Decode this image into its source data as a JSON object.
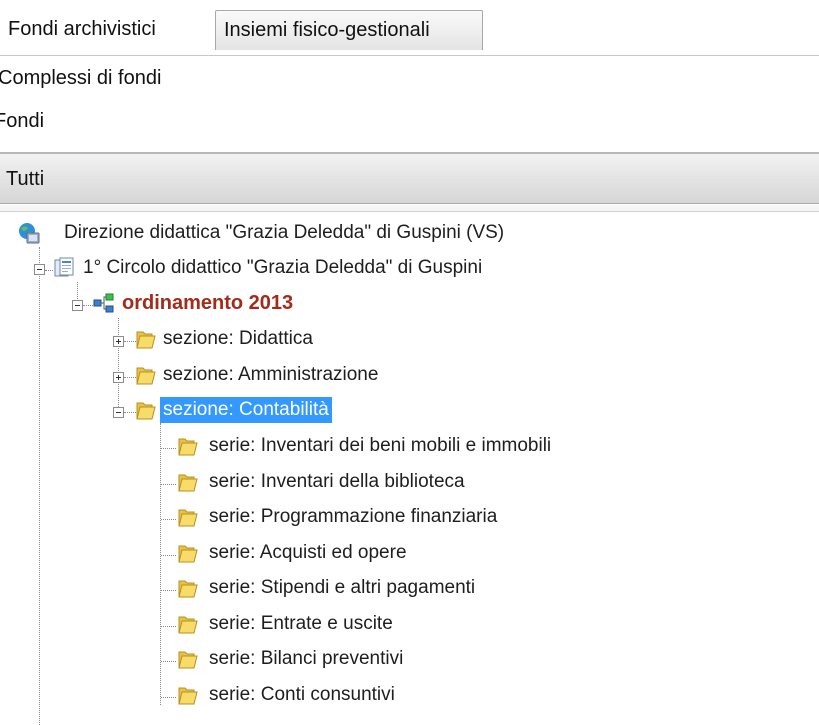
{
  "tabs": {
    "fondi_archivistici": "Fondi archivistici",
    "insiemi_fisico_gestionali": "Insiemi fisico-gestionali"
  },
  "nav": {
    "complessi": "Complessi di fondi",
    "fondi": "Fondi"
  },
  "section": {
    "title": "Tutti"
  },
  "tree": {
    "root": {
      "label": "Direzione didattica \"Grazia Deledda\" di Guspini (VS)",
      "icon": "globe-icon"
    },
    "fondo": {
      "label": "1° Circolo didattico \"Grazia Deledda\" di Guspini",
      "icon": "documents-icon",
      "expanded": true
    },
    "ordinamento": {
      "label": "ordinamento 2013",
      "icon": "hierarchy-icon",
      "expanded": true,
      "color": "#a52a1a"
    },
    "sezioni": [
      {
        "label": "sezione: Didattica",
        "expanded": false
      },
      {
        "label": "sezione: Amministrazione",
        "expanded": false
      },
      {
        "label": "sezione: Contabilità",
        "expanded": true,
        "selected": true
      }
    ],
    "serie": [
      "serie: Inventari dei beni mobili e immobili",
      "serie: Inventari della biblioteca",
      "serie: Programmazione finanziaria",
      "serie: Acquisti ed opere",
      "serie: Stipendi e altri pagamenti",
      "serie: Entrate e uscite",
      "serie: Bilanci preventivi",
      "serie: Conti consuntivi"
    ]
  },
  "colors": {
    "selection": "#3399ff",
    "ordinamento_text": "#a52a1a",
    "folder": "#f2d35b"
  }
}
